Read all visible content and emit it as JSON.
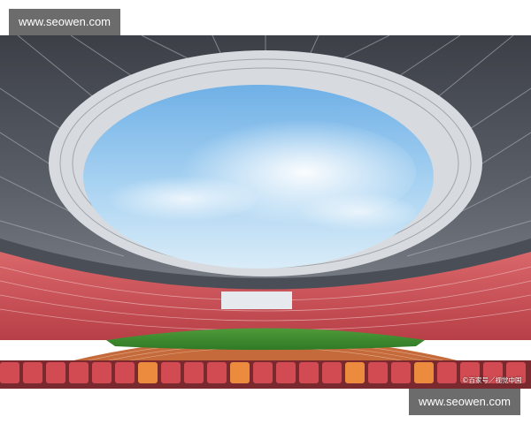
{
  "watermark": {
    "top_text": "www.seowen.com",
    "bottom_text": "www.seowen.com"
  },
  "credit": {
    "text": "©百家号／视觉中国"
  },
  "colors": {
    "sky": "#8fc4ee",
    "roof_steel": "#5a5e66",
    "seats_red": "#c8454d",
    "seats_orange": "#e07a3c",
    "field_green": "#3d8a2f",
    "track": "#c56a3a",
    "watermark_bg": "#5f5f5f"
  }
}
